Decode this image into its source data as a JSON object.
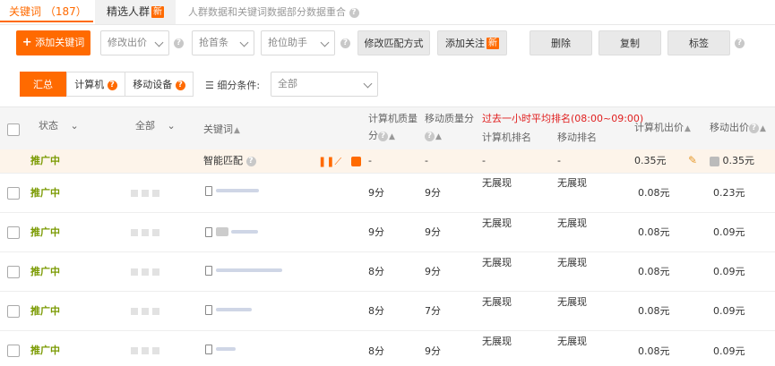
{
  "tabs": {
    "keyword": "关键词 （187）",
    "crowd": "精选人群",
    "new_badge": "新",
    "note": "人群数据和关键词数据部分数据重合"
  },
  "toolbar": {
    "add_keyword": "添加关键词",
    "modify_bid": "修改出价",
    "grab_first": "抢首条",
    "grab_assistant": "抢位助手",
    "modify_match": "修改匹配方式",
    "add_follow": "添加关注",
    "follow_badge": "新",
    "delete": "删除",
    "copy": "复制",
    "tag": "标签"
  },
  "filter": {
    "summary": "汇总",
    "computer": "计算机",
    "mobile": "移动设备",
    "subdivide_label": "细分条件:",
    "subdivide_value": "全部"
  },
  "table": {
    "headers": {
      "status": "状态",
      "all": "全部",
      "keyword": "关键词",
      "pc_quality_1": "计算机质量",
      "pc_quality_2": "分",
      "mobile_quality_1": "移动质量分",
      "rank_group": "过去一小时平均排名(08:00~09:00)",
      "pc_rank": "计算机排名",
      "mobile_rank": "移动排名",
      "pc_bid": "计算机出价",
      "mobile_bid": "移动出价"
    },
    "summary_row": {
      "status": "推广中",
      "keyword": "智能匹配",
      "pc_quality": "-",
      "mobile_quality": "-",
      "pc_rank": "-",
      "mobile_rank": "-",
      "pc_bid": "0.35元",
      "mobile_bid": "0.35元"
    },
    "rows": [
      {
        "status": "推广中",
        "pc_quality": "9分",
        "mobile_quality": "9分",
        "pc_rank": "无展现",
        "mobile_rank": "无展现",
        "pc_bid": "0.08元",
        "mobile_bid": "0.23元"
      },
      {
        "status": "推广中",
        "pc_quality": "9分",
        "mobile_quality": "9分",
        "pc_rank": "无展现",
        "mobile_rank": "无展现",
        "pc_bid": "0.08元",
        "mobile_bid": "0.09元"
      },
      {
        "status": "推广中",
        "pc_quality": "8分",
        "mobile_quality": "9分",
        "pc_rank": "无展现",
        "mobile_rank": "无展现",
        "pc_bid": "0.08元",
        "mobile_bid": "0.09元"
      },
      {
        "status": "推广中",
        "pc_quality": "8分",
        "mobile_quality": "7分",
        "pc_rank": "无展现",
        "mobile_rank": "无展现",
        "pc_bid": "0.08元",
        "mobile_bid": "0.09元"
      },
      {
        "status": "推广中",
        "pc_quality": "8分",
        "mobile_quality": "9分",
        "pc_rank": "无展现",
        "mobile_rank": "无展现",
        "pc_bid": "0.08元",
        "mobile_bid": "0.09元"
      }
    ]
  },
  "colors": {
    "accent": "#ff6a00",
    "status_green": "#7a9a01",
    "alert_red": "#e02020"
  }
}
